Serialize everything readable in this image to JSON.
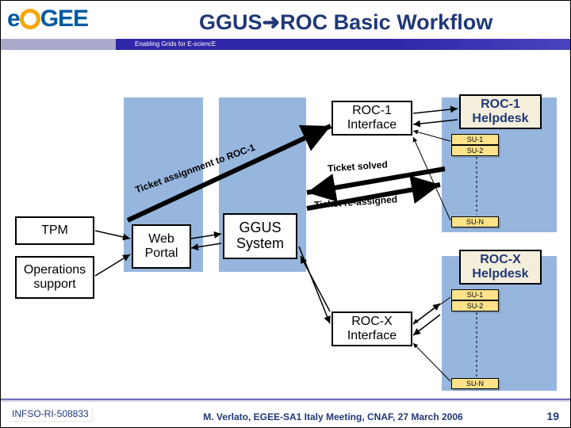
{
  "header": {
    "logo_text": "GEE",
    "title_left": "GGUS",
    "title_right": "ROC Basic Workflow",
    "subtitle": "Enabling Grids for E-sciencE"
  },
  "boxes": {
    "tpm": "TPM",
    "ops_line1": "Operations",
    "ops_line2": "support",
    "webportal_line1": "Web",
    "webportal_line2": "Portal",
    "ggus_line1": "GGUS",
    "ggus_line2": "System",
    "roc1_int_line1": "ROC-1",
    "roc1_int_line2": "Interface",
    "rocx_int_line1": "ROC-X",
    "rocx_int_line2": "Interface",
    "roc1_help_line1": "ROC-1",
    "roc1_help_line2": "Helpdesk",
    "rocx_help_line1": "ROC-X",
    "rocx_help_line2": "Helpdesk"
  },
  "su": {
    "r1_1": "SU-1",
    "r1_2": "SU-2",
    "r1_n": "SU-N",
    "rx_1": "SU-1",
    "rx_2": "SU-2",
    "rx_n": "SU-N"
  },
  "flows": {
    "assign": "Ticket assignment to ROC-1",
    "solved": "Ticket solved",
    "reassign": "Ticket re-assigned"
  },
  "footer": {
    "left": "INFSO-RI-508833",
    "mid": "M. Verlato, EGEE-SA1 Italy Meeting, CNAF, 27 March 2006",
    "page": "19"
  }
}
